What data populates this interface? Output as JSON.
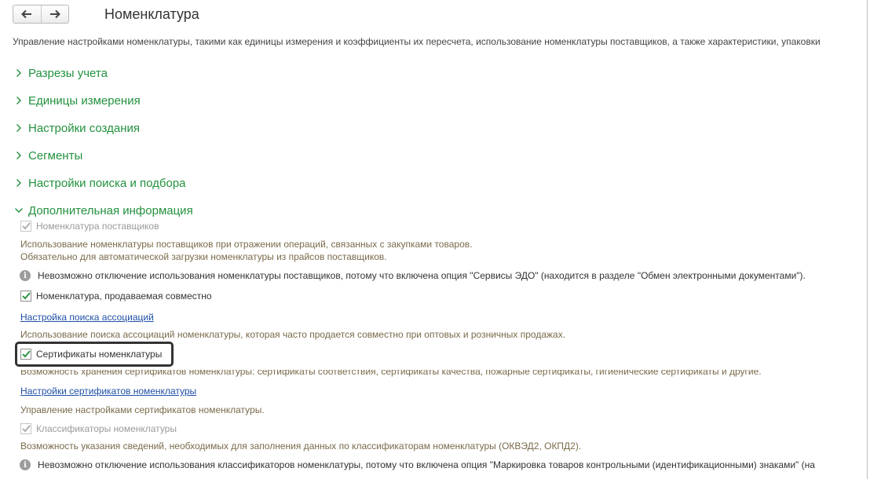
{
  "header": {
    "title": "Номенклатура",
    "description": "Управление настройками номенклатуры, такими как единицы измерения и коэффициенты их пересчета, использование номенклатуры поставщиков, а также характеристики, упаковки"
  },
  "groups": [
    {
      "label": "Разрезы учета",
      "expanded": false
    },
    {
      "label": "Единицы измерения",
      "expanded": false
    },
    {
      "label": "Настройки создания",
      "expanded": false
    },
    {
      "label": "Сегменты",
      "expanded": false
    },
    {
      "label": "Настройки поиска и подбора",
      "expanded": false
    },
    {
      "label": "Дополнительная информация",
      "expanded": true
    }
  ],
  "additional": {
    "supplier_items": {
      "label": "Номенклатура поставщиков",
      "checked": true,
      "disabled": true,
      "note1": "Использование номенклатуры поставщиков при отражении операций, связанных с закупками товаров.",
      "note2": "Обязательно для автоматической загрузки номенклатуры из прайсов поставщиков.",
      "info": "Невозможно отключение использования номенклатуры поставщиков, потому что включена опция \"Сервисы ЭДО\" (находится в разделе \"Обмен электронными документами\")."
    },
    "joint_items": {
      "label": "Номенклатура, продаваемая совместно",
      "checked": true,
      "link": "Настройка поиска ассоциаций",
      "note": "Использование поиска ассоциаций номенклатуры, которая часто продается совместно при оптовых и розничных продажах."
    },
    "certificates": {
      "label": "Сертификаты номенклатуры",
      "checked": true,
      "note": "Возможность хранения сертификатов номенклатуры: сертификаты соответствия, сертификаты качества, пожарные сертификаты, гигиенические сертификаты и другие.",
      "link": "Настройки сертификатов номенклатуры",
      "link_note": "Управление настройками сертификатов номенклатуры."
    },
    "classifiers": {
      "label": "Классификаторы номенклатуры",
      "checked": true,
      "disabled": true,
      "note": "Возможность указания сведений, необходимых для заполнения данных по классификаторам номенклатуры (ОКВЭД2, ОКПД2).",
      "info": "Невозможно отключение использования классификаторов номенклатуры, потому что включена опция \"Маркировка товаров контрольными (идентификационными) знаками\" (на"
    }
  },
  "colors": {
    "group": "#22913e",
    "link": "#1f4fa8",
    "note": "#7a6a4a",
    "check": "#1f8f3a",
    "check_disabled": "#a8a8a8"
  },
  "icons": {
    "back": "arrow-left-icon",
    "forward": "arrow-right-icon",
    "collapsed": "chevron-right-icon",
    "expanded": "chevron-down-icon",
    "info": "info-icon",
    "check": "checkmark-icon"
  }
}
